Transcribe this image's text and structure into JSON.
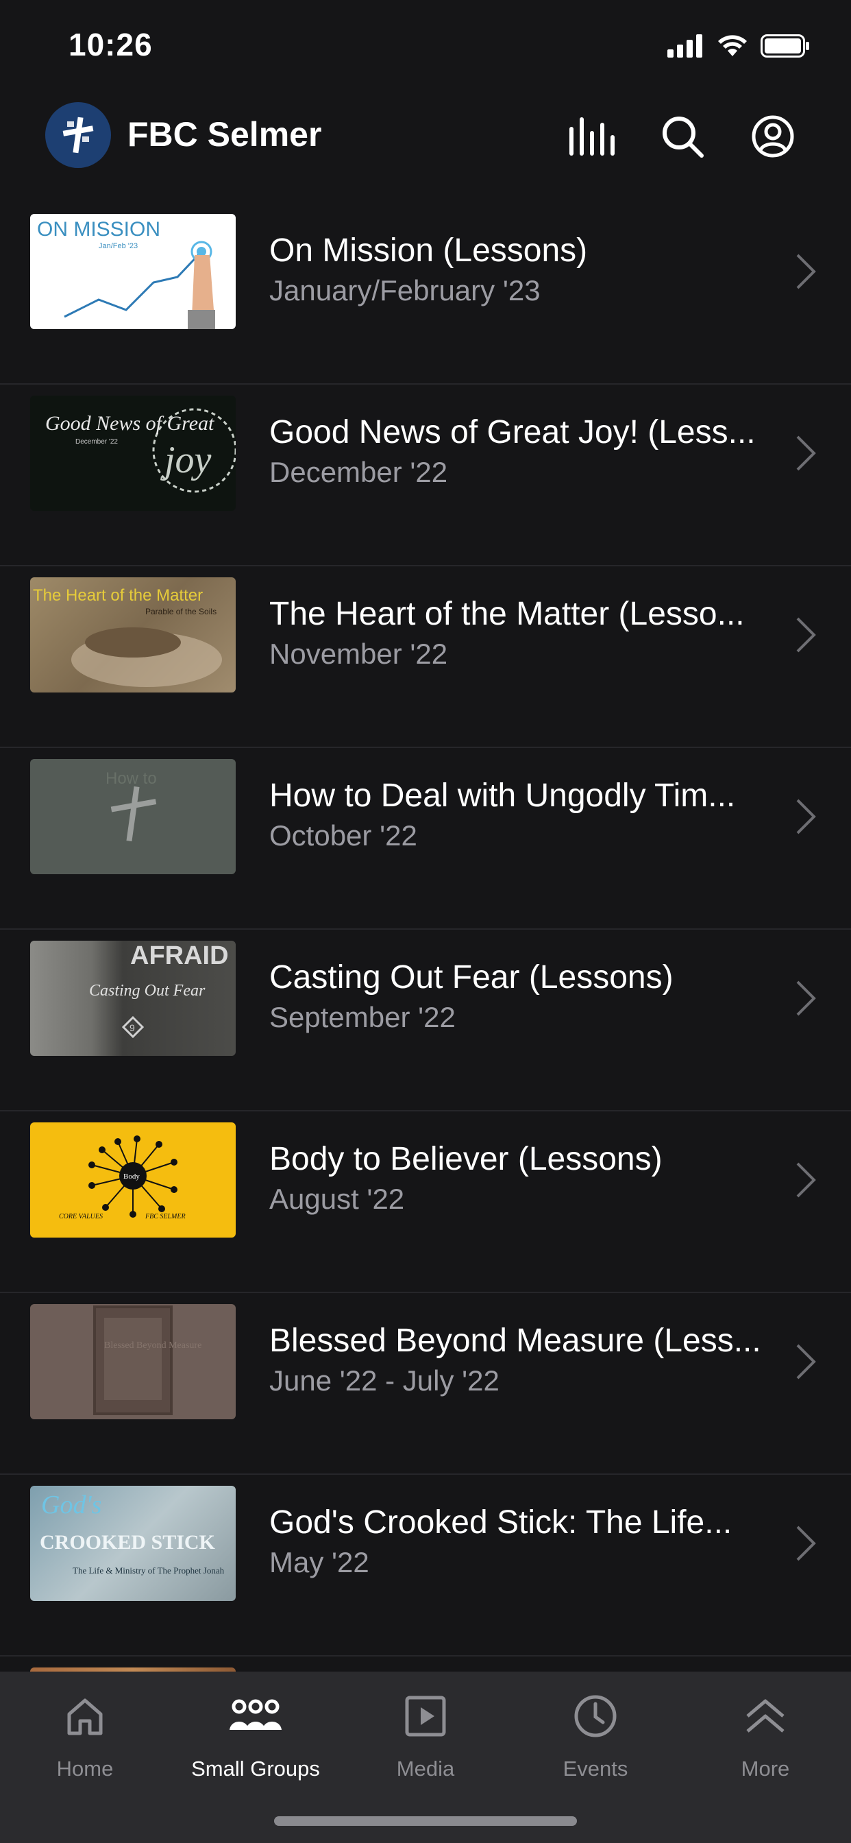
{
  "status": {
    "time": "10:26"
  },
  "header": {
    "title": "FBC Selmer"
  },
  "items": [
    {
      "title": "On Mission (Lessons)",
      "subtitle": "January/February '23",
      "thumb_text": "ON MISSION",
      "thumb_sub": "Jan/Feb '23"
    },
    {
      "title": "Good News of Great Joy! (Less...",
      "subtitle": "December '22",
      "thumb_text": "Good News of Great",
      "thumb_sub": "December '22",
      "thumb_word": "joy"
    },
    {
      "title": "The Heart of the Matter (Lesso...",
      "subtitle": "November '22",
      "thumb_text": "The Heart of the Matter",
      "thumb_sub": "Parable of the Soils"
    },
    {
      "title": "How to Deal with Ungodly Tim...",
      "subtitle": "October '22",
      "thumb_text": "How to"
    },
    {
      "title": "Casting Out Fear (Lessons)",
      "subtitle": "September '22",
      "thumb_text": "AFRAID",
      "thumb_sub": "Casting Out Fear"
    },
    {
      "title": "Body to Believer (Lessons)",
      "subtitle": "August '22",
      "thumb_text": "Body",
      "thumb_left": "CORE VALUES",
      "thumb_right": "FBC SELMER"
    },
    {
      "title": "Blessed Beyond Measure (Less...",
      "subtitle": "June '22 - July '22",
      "thumb_text": "Blessed Beyond Measure"
    },
    {
      "title": "God's Crooked Stick: The Life...",
      "subtitle": "May '22",
      "thumb_text": "God's",
      "thumb_word": "CROOKED STICK",
      "thumb_sub": "The Life & Ministry of The Prophet Jonah"
    }
  ],
  "tabs": [
    {
      "label": "Home",
      "icon": "house-icon"
    },
    {
      "label": "Small Groups",
      "icon": "people-icon"
    },
    {
      "label": "Media",
      "icon": "play-square-icon"
    },
    {
      "label": "Events",
      "icon": "clock-icon"
    },
    {
      "label": "More",
      "icon": "double-chevron-up-icon"
    }
  ],
  "colors": {
    "background": "#151517",
    "tabbar": "#2b2b2e",
    "accent_logo": "#1d3f72"
  }
}
